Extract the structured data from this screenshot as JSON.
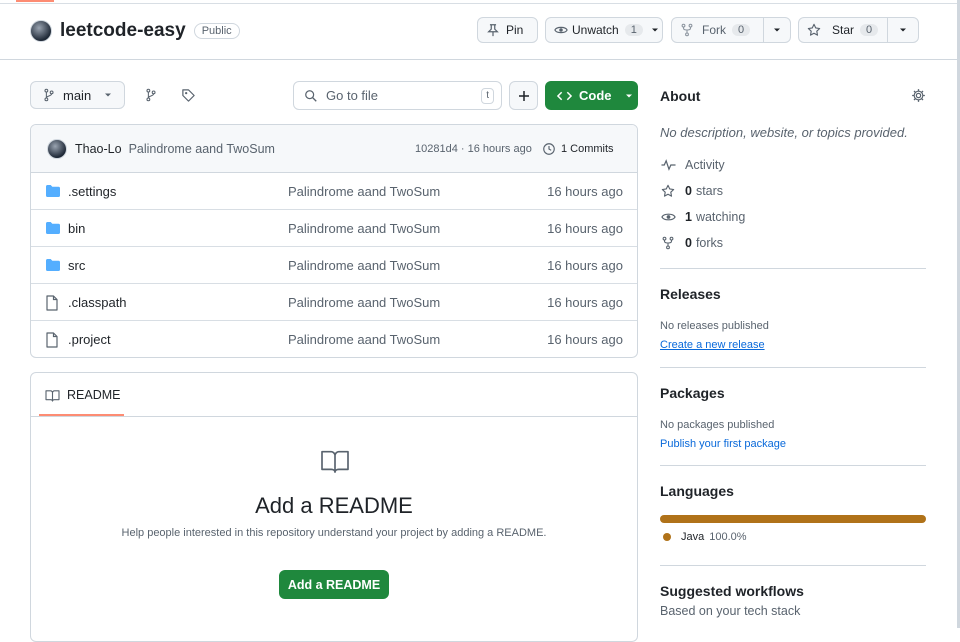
{
  "repo": {
    "name": "leetcode-easy",
    "visibility": "Public"
  },
  "actions": {
    "pin": "Pin",
    "unwatch": "Unwatch",
    "unwatch_count": "1",
    "fork": "Fork",
    "fork_count": "0",
    "star": "Star",
    "star_count": "0"
  },
  "toolbar": {
    "branch": "main",
    "search_placeholder": "Go to file",
    "search_key": "t",
    "code": "Code"
  },
  "commit": {
    "author": "Thao-Lo",
    "message": "Palindrome aand TwoSum",
    "hash_time": "10281d4 · 16 hours ago",
    "commits": "1 Commits"
  },
  "files": [
    {
      "name": ".settings",
      "type": "folder",
      "message": "Palindrome aand TwoSum",
      "time": "16 hours ago"
    },
    {
      "name": "bin",
      "type": "folder",
      "message": "Palindrome aand TwoSum",
      "time": "16 hours ago"
    },
    {
      "name": "src",
      "type": "folder",
      "message": "Palindrome aand TwoSum",
      "time": "16 hours ago"
    },
    {
      "name": ".classpath",
      "type": "file",
      "message": "Palindrome aand TwoSum",
      "time": "16 hours ago"
    },
    {
      "name": ".project",
      "type": "file",
      "message": "Palindrome aand TwoSum",
      "time": "16 hours ago"
    }
  ],
  "readme": {
    "tab": "README",
    "title": "Add a README",
    "description": "Help people interested in this repository understand your project by adding a README.",
    "button": "Add a README"
  },
  "about": {
    "heading": "About",
    "description": "No description, website, or topics provided.",
    "activity": "Activity",
    "stars_count": "0",
    "stars_label": "stars",
    "watching_count": "1",
    "watching_label": "watching",
    "forks_count": "0",
    "forks_label": "forks"
  },
  "releases": {
    "heading": "Releases",
    "none": "No releases published",
    "link": "Create a new release"
  },
  "packages": {
    "heading": "Packages",
    "none": "No packages published",
    "link": "Publish your first package"
  },
  "languages": {
    "heading": "Languages",
    "items": [
      {
        "name": "Java",
        "percent": "100.0%",
        "color": "#b07219",
        "fraction": 1.0
      }
    ]
  },
  "workflows": {
    "heading": "Suggested workflows",
    "subtitle": "Based on your tech stack"
  },
  "colors": {
    "green": "#1f883d",
    "accent": "#fd8c73",
    "link": "#0969da"
  }
}
